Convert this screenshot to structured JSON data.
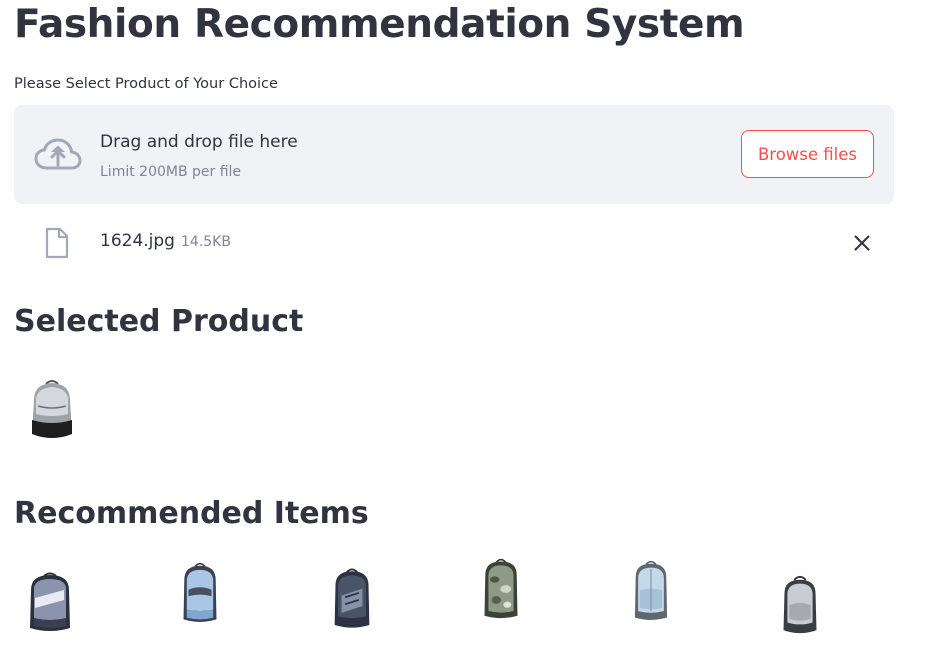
{
  "page": {
    "title": "Fashion Recommendation System",
    "upload_label": "Please Select Product of Your Choice"
  },
  "uploader": {
    "drop_text": "Drag and drop file here",
    "limit_text": "Limit 200MB per file",
    "browse_label": "Browse files",
    "icon": "cloud-upload-icon"
  },
  "uploaded_file": {
    "name": "1624.jpg",
    "size": "14.5KB",
    "icon": "file-icon",
    "remove_icon": "close-icon"
  },
  "selected": {
    "heading": "Selected Product",
    "image": "backpack-grey-black"
  },
  "recommended": {
    "heading": "Recommended Items",
    "items": [
      "nike-backpack-grey",
      "backpack-light-blue",
      "nike-backpack-navy",
      "backpack-camo",
      "backpack-sky-blue",
      "backpack-small-grey"
    ]
  },
  "colors": {
    "accent": "#ff4b4b",
    "text": "#31333f",
    "muted": "#808495",
    "dropzone_bg": "#f0f2f6"
  }
}
